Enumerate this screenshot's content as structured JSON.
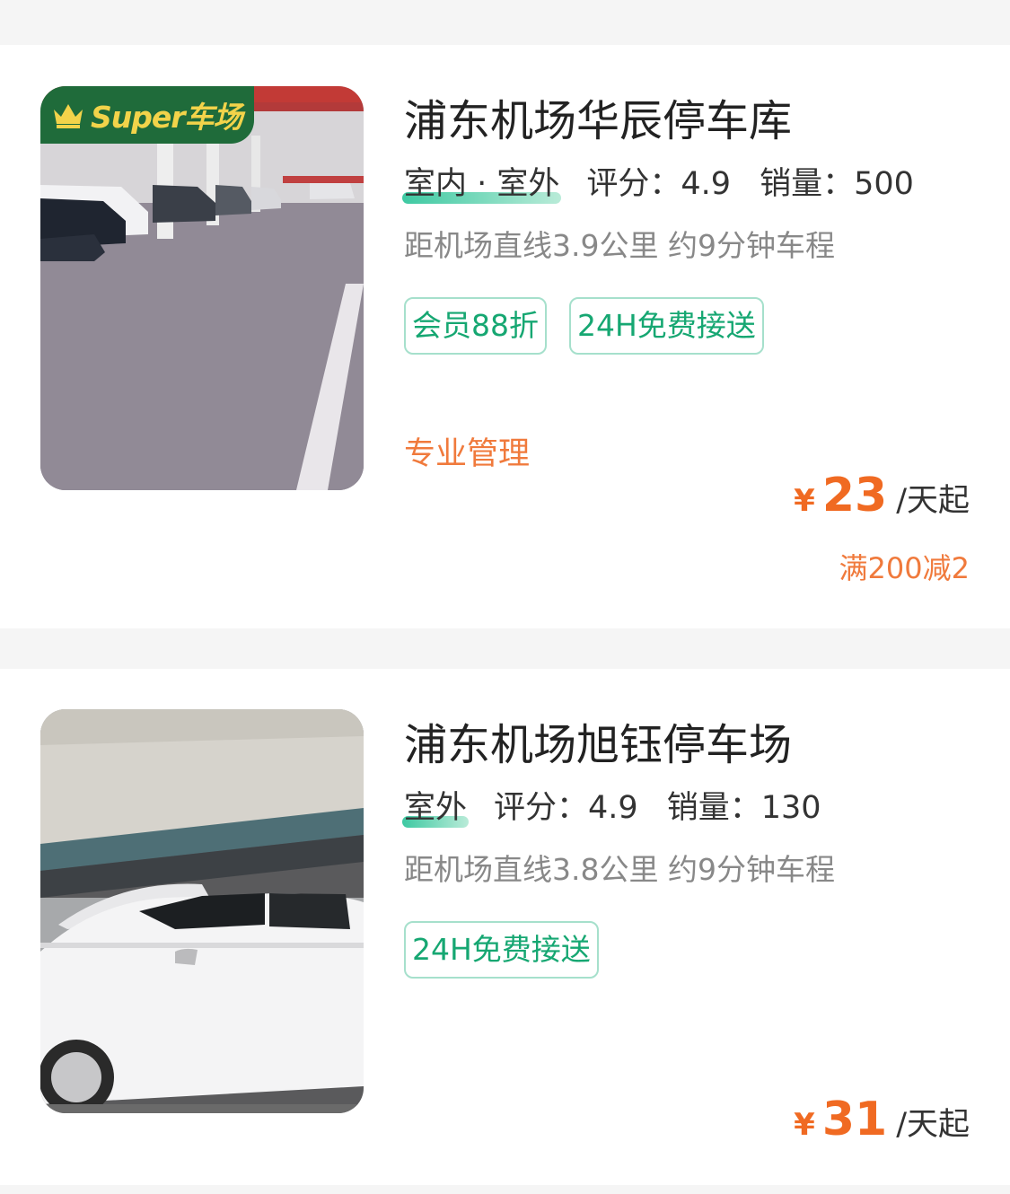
{
  "lots": [
    {
      "badge": "Super车场",
      "name": "浦东机场华辰停车库",
      "type": "室内 · 室外",
      "rating_label": "评分：4.9",
      "sales_label": "销量：500",
      "distance": "距机场直线3.9公里 约9分钟车程",
      "tags": [
        "会员88折",
        "24H免费接送"
      ],
      "feature": "专业管理",
      "price": {
        "currency": "¥",
        "amount": "23",
        "unit": "/天起"
      },
      "promo": "满200减2",
      "image": "indoor-garage-photo"
    },
    {
      "name": "浦东机场旭钰停车场",
      "type": "室外",
      "rating_label": "评分：4.9",
      "sales_label": "销量：130",
      "distance": "距机场直线3.8公里 约9分钟车程",
      "tags": [
        "24H免费接送"
      ],
      "price": {
        "currency": "¥",
        "amount": "31",
        "unit": "/天起"
      },
      "image": "white-car-carport-photo"
    }
  ],
  "colors": {
    "accent_orange": "#f06a22",
    "tag_green": "#16a772",
    "badge_green": "#1f6b3a",
    "badge_gold": "#f2d34a",
    "page_bg": "#f5f5f5"
  }
}
